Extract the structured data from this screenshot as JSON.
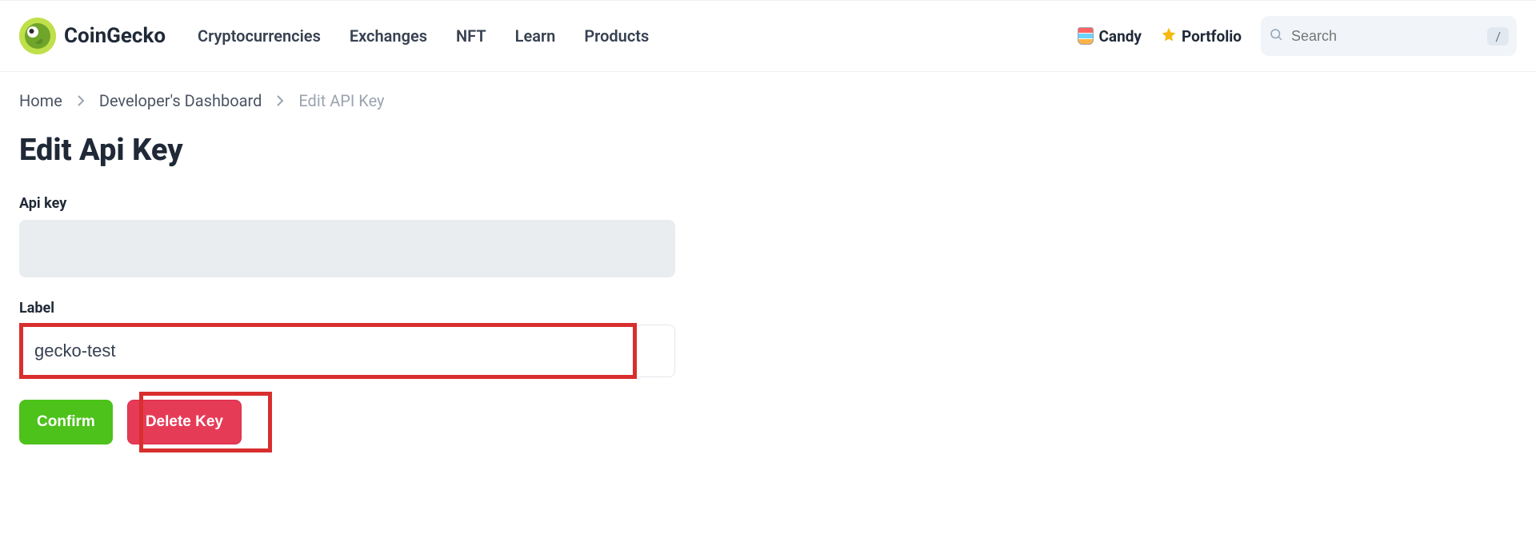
{
  "brand": {
    "name": "CoinGecko"
  },
  "nav": {
    "items": [
      {
        "label": "Cryptocurrencies"
      },
      {
        "label": "Exchanges"
      },
      {
        "label": "NFT"
      },
      {
        "label": "Learn"
      },
      {
        "label": "Products"
      }
    ],
    "candy": "Candy",
    "portfolio": "Portfolio",
    "search_placeholder": "Search",
    "search_kbd": "/"
  },
  "breadcrumbs": {
    "items": [
      {
        "label": "Home"
      },
      {
        "label": "Developer's Dashboard"
      },
      {
        "label": "Edit API Key"
      }
    ]
  },
  "page": {
    "title": "Edit Api Key",
    "api_key_label": "Api key",
    "api_key_value": "",
    "label_label": "Label",
    "label_value": "gecko-test",
    "confirm_btn": "Confirm",
    "delete_btn": "Delete Key"
  }
}
